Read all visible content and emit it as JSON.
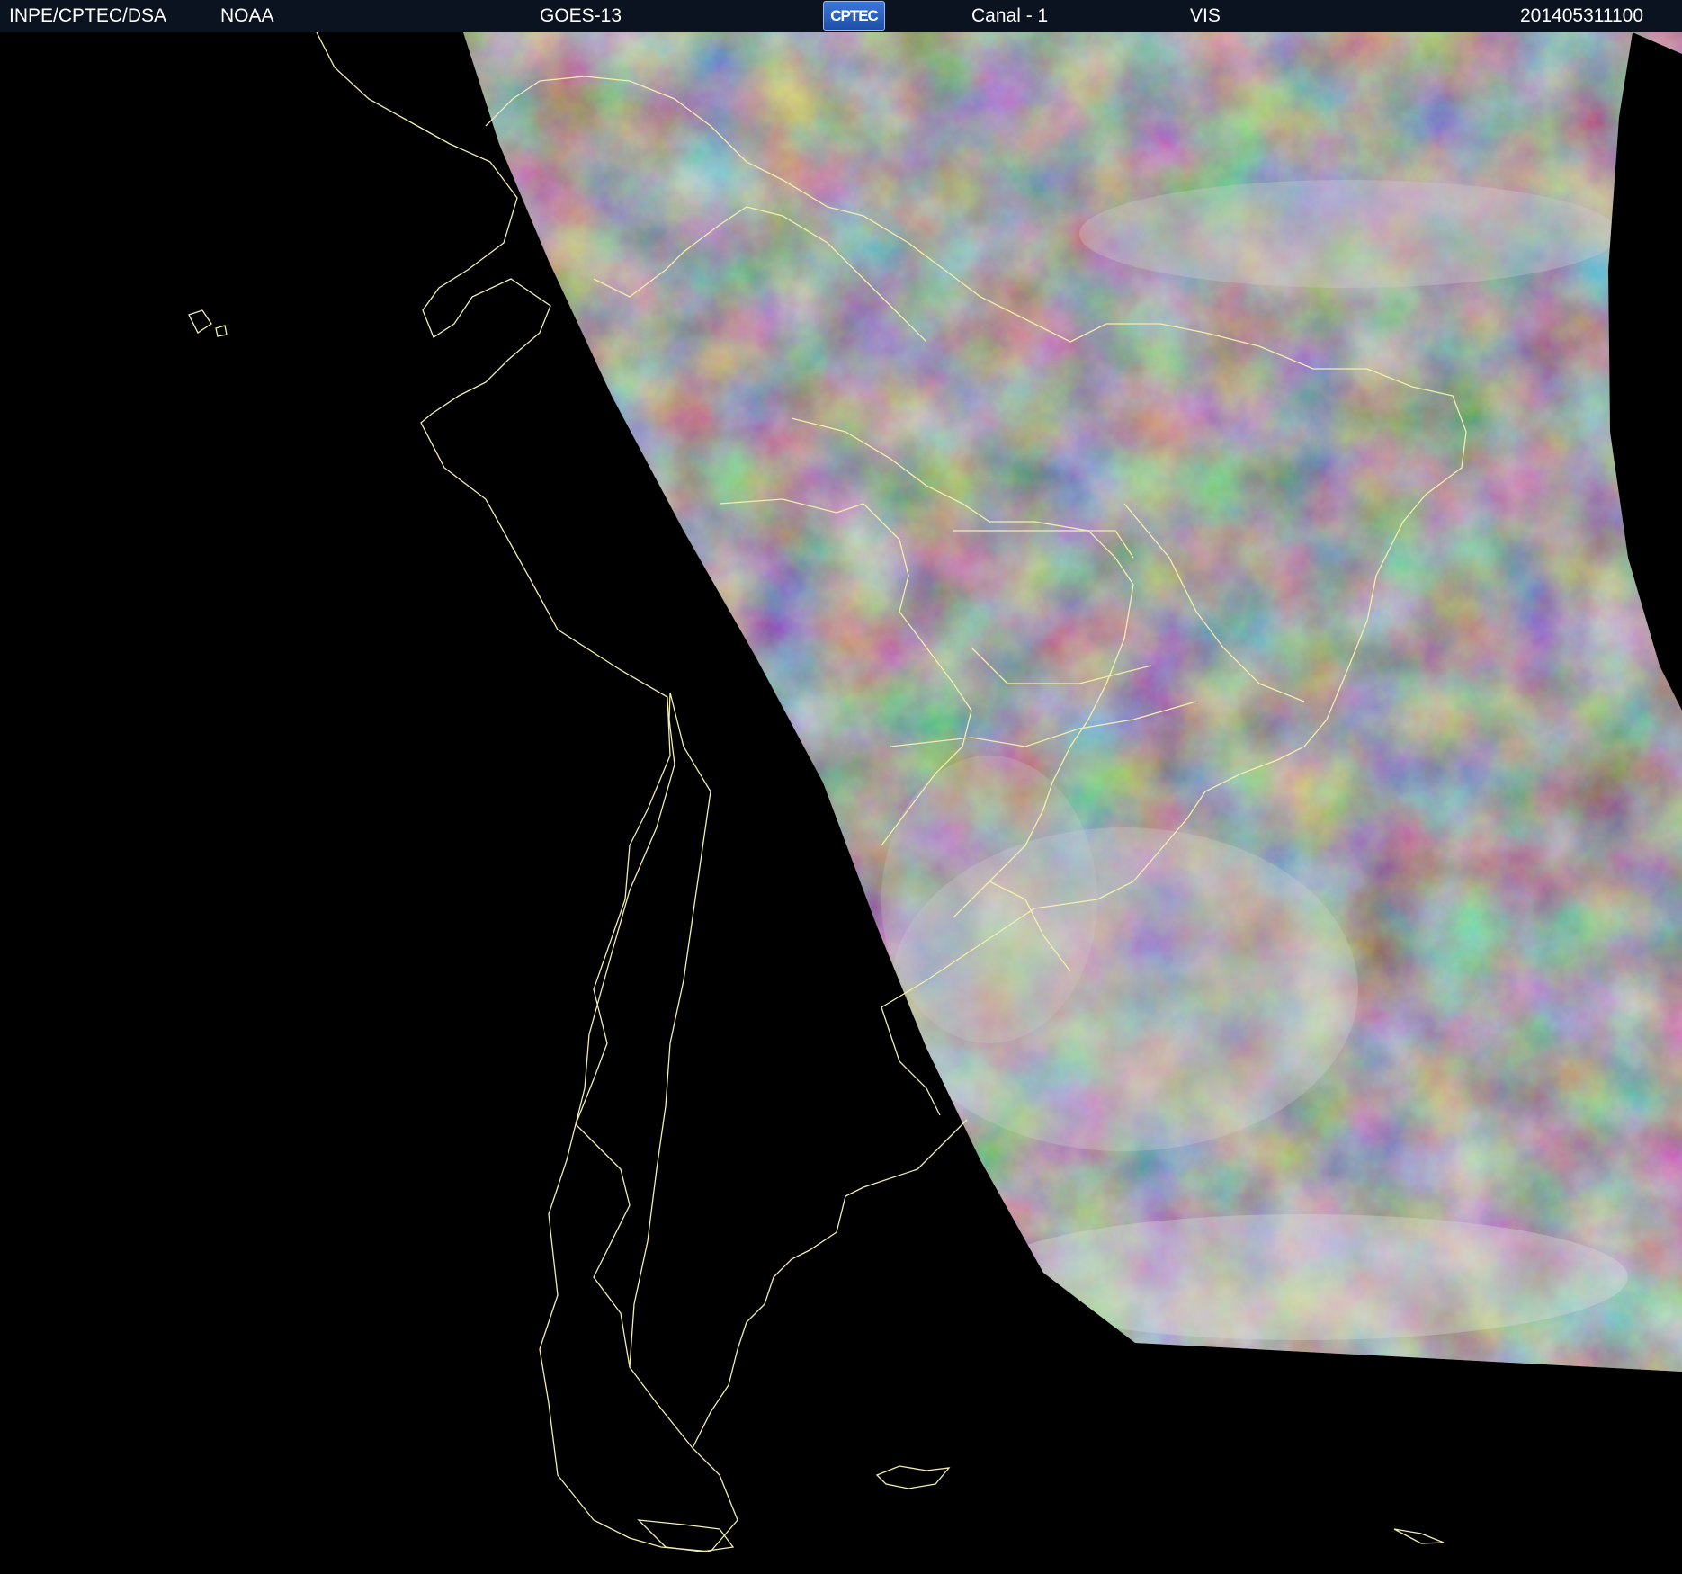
{
  "header": {
    "agency": "INPE/CPTEC/DSA",
    "source": "NOAA",
    "satellite": "GOES-13",
    "logo_text": "CPTEC",
    "channel": "Canal - 1",
    "band": "VIS",
    "timestamp": "201405311100"
  },
  "colors": {
    "header_bg": "#0b1220",
    "border_lines": "#f5f0b0",
    "background": "#000000"
  },
  "image": {
    "description_icon": "satellite-visible-image"
  }
}
